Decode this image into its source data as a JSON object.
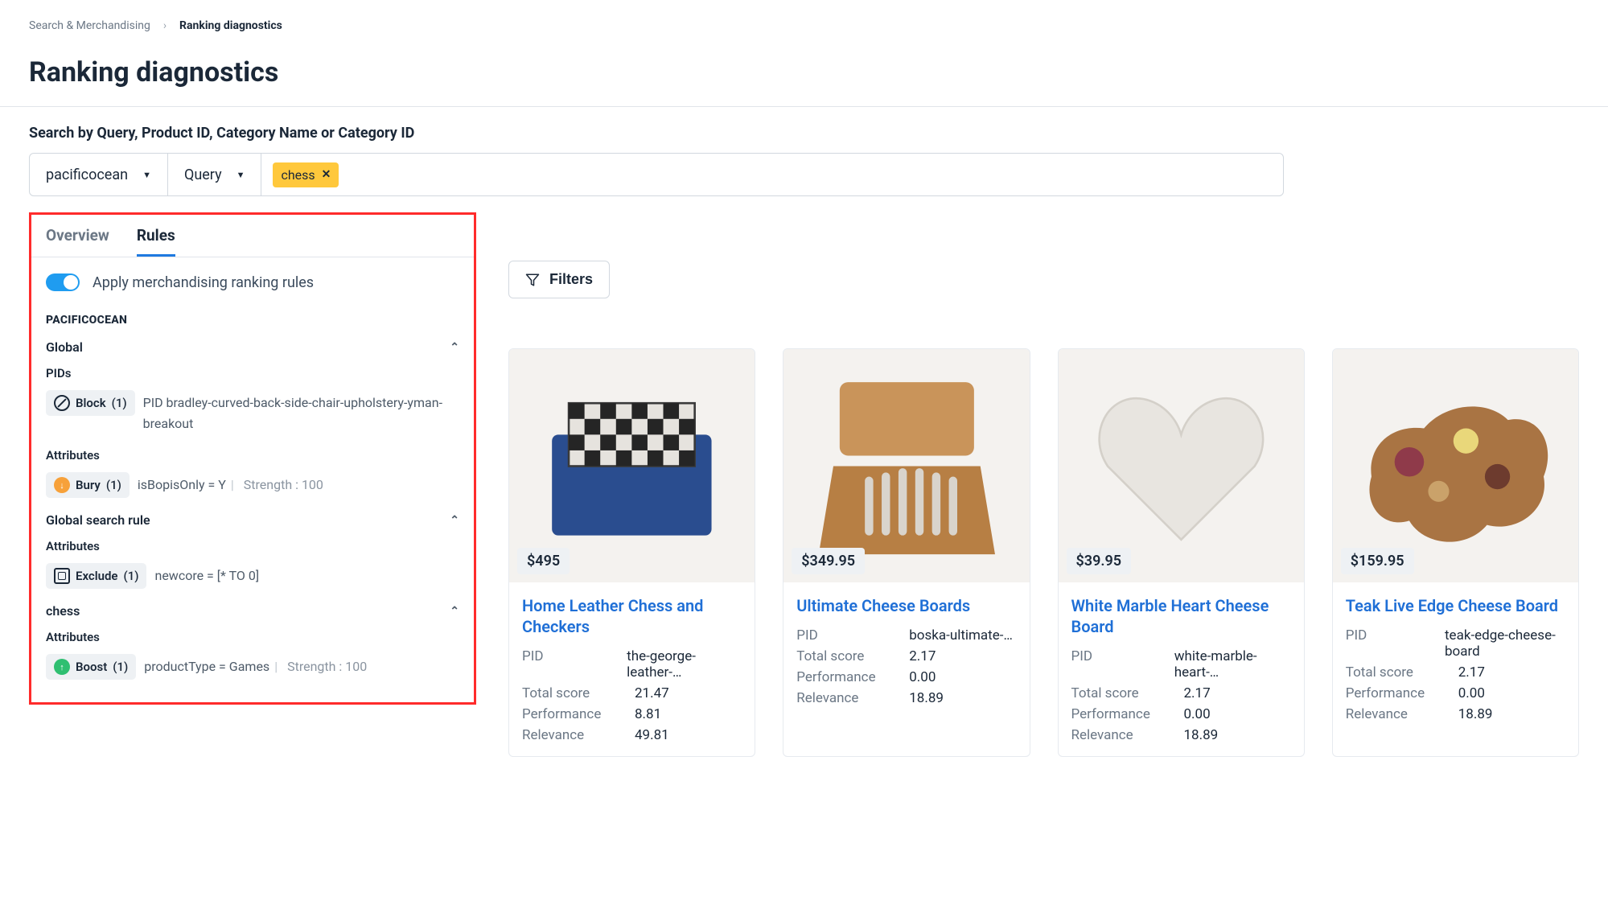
{
  "breadcrumb": {
    "parent": "Search & Merchandising",
    "current": "Ranking diagnostics"
  },
  "page_title": "Ranking diagnostics",
  "search_label": "Search by Query, Product ID, Category Name or Category ID",
  "selectors": {
    "account": "pacificocean",
    "mode": "Query"
  },
  "chip": {
    "label": "chess"
  },
  "tabs": {
    "overview": "Overview",
    "rules": "Rules"
  },
  "toggle_label": "Apply merchandising ranking rules",
  "section_caps": "PACIFICOCEAN",
  "groups": {
    "global": {
      "title": "Global",
      "pids_label": "PIDs",
      "block_count": "(1)",
      "block_label": "Block",
      "block_desc": "PID bradley-curved-back-side-chair-upholstery-yman-breakout",
      "attr_label": "Attributes",
      "bury_label": "Bury",
      "bury_count": "(1)",
      "bury_cond": "isBopisOnly = Y",
      "bury_strength": "Strength : 100"
    },
    "gsr": {
      "title": "Global search rule",
      "attr_label": "Attributes",
      "exclude_label": "Exclude",
      "exclude_count": "(1)",
      "exclude_cond": "newcore = [* TO 0]"
    },
    "chess": {
      "title": "chess",
      "attr_label": "Attributes",
      "boost_label": "Boost",
      "boost_count": "(1)",
      "boost_cond": "productType = Games",
      "boost_strength": "Strength : 100"
    }
  },
  "filters_label": "Filters",
  "stats_labels": {
    "pid": "PID",
    "total": "Total score",
    "perf": "Performance",
    "rel": "Relevance"
  },
  "products": [
    {
      "price": "$495",
      "title": "Home Leather Chess and Checkers",
      "pid": "the-george-leather-…",
      "total": "21.47",
      "perf": "8.81",
      "rel": "49.81"
    },
    {
      "price": "$349.95",
      "title": "Ultimate Cheese Boards",
      "pid": "boska-ultimate-…",
      "total": "2.17",
      "perf": "0.00",
      "rel": "18.89"
    },
    {
      "price": "$39.95",
      "title": "White Marble Heart Cheese Board",
      "pid": "white-marble-heart-…",
      "total": "2.17",
      "perf": "0.00",
      "rel": "18.89"
    },
    {
      "price": "$159.95",
      "title": "Teak Live Edge Cheese Board",
      "pid": "teak-edge-cheese-board",
      "total": "2.17",
      "perf": "0.00",
      "rel": "18.89"
    }
  ]
}
